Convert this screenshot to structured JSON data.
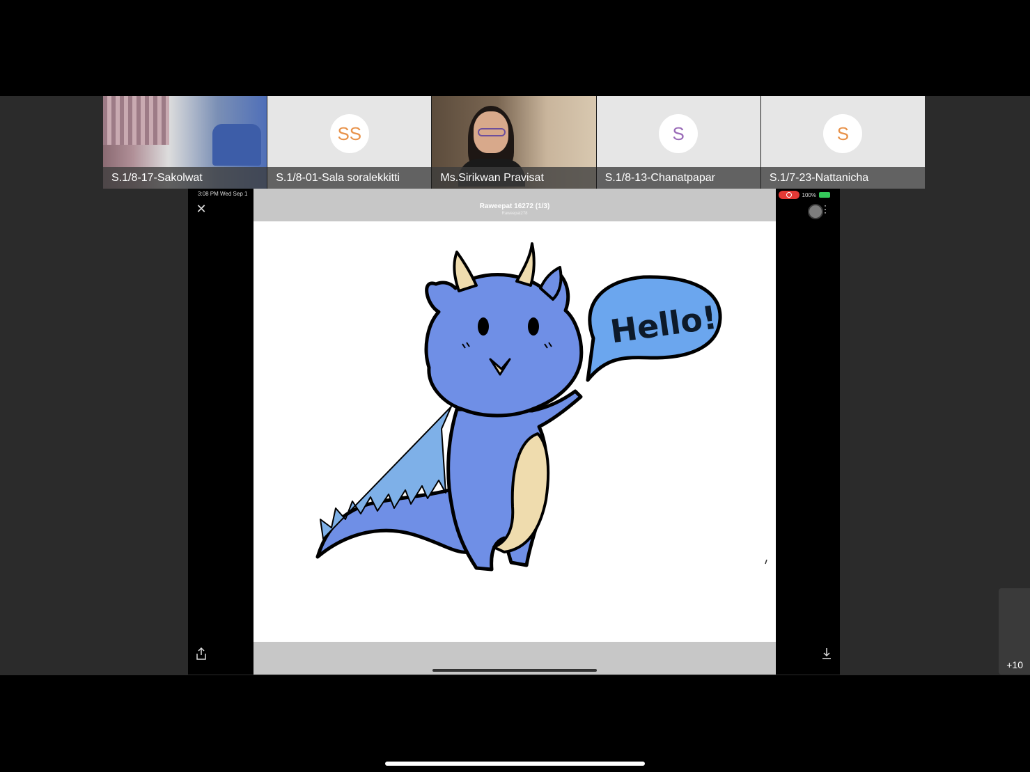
{
  "participants": [
    {
      "name": "S.1/8-17-Sakolwat",
      "type": "video"
    },
    {
      "name": "S.1/8-01-Sala soralekkitti",
      "type": "avatar",
      "initials": "SS",
      "color": "#e8924a"
    },
    {
      "name": "Ms.Sirikwan Pravisat",
      "type": "video"
    },
    {
      "name": "S.1/8-13-Chanatpapar",
      "type": "avatar",
      "initials": "S",
      "color": "#9a6bb8"
    },
    {
      "name": "S.1/7-23-Nattanicha",
      "type": "avatar",
      "initials": "S",
      "color": "#e8924a"
    }
  ],
  "share": {
    "status_time": "3:08 PM   Wed Sep 1",
    "battery": "100%",
    "viewer_title": "Raweepat 16272 (1/3)",
    "viewer_subtitle": "Raweepat278",
    "speech_text": "Hello!",
    "icons": [
      "close-icon",
      "share-icon",
      "download-icon",
      "more-icon"
    ]
  },
  "overflow": {
    "count": "+10"
  },
  "colors": {
    "dragon_body": "#6f8fe6",
    "dragon_belly": "#efdcae",
    "speech_bubble": "#6ba6ee"
  }
}
